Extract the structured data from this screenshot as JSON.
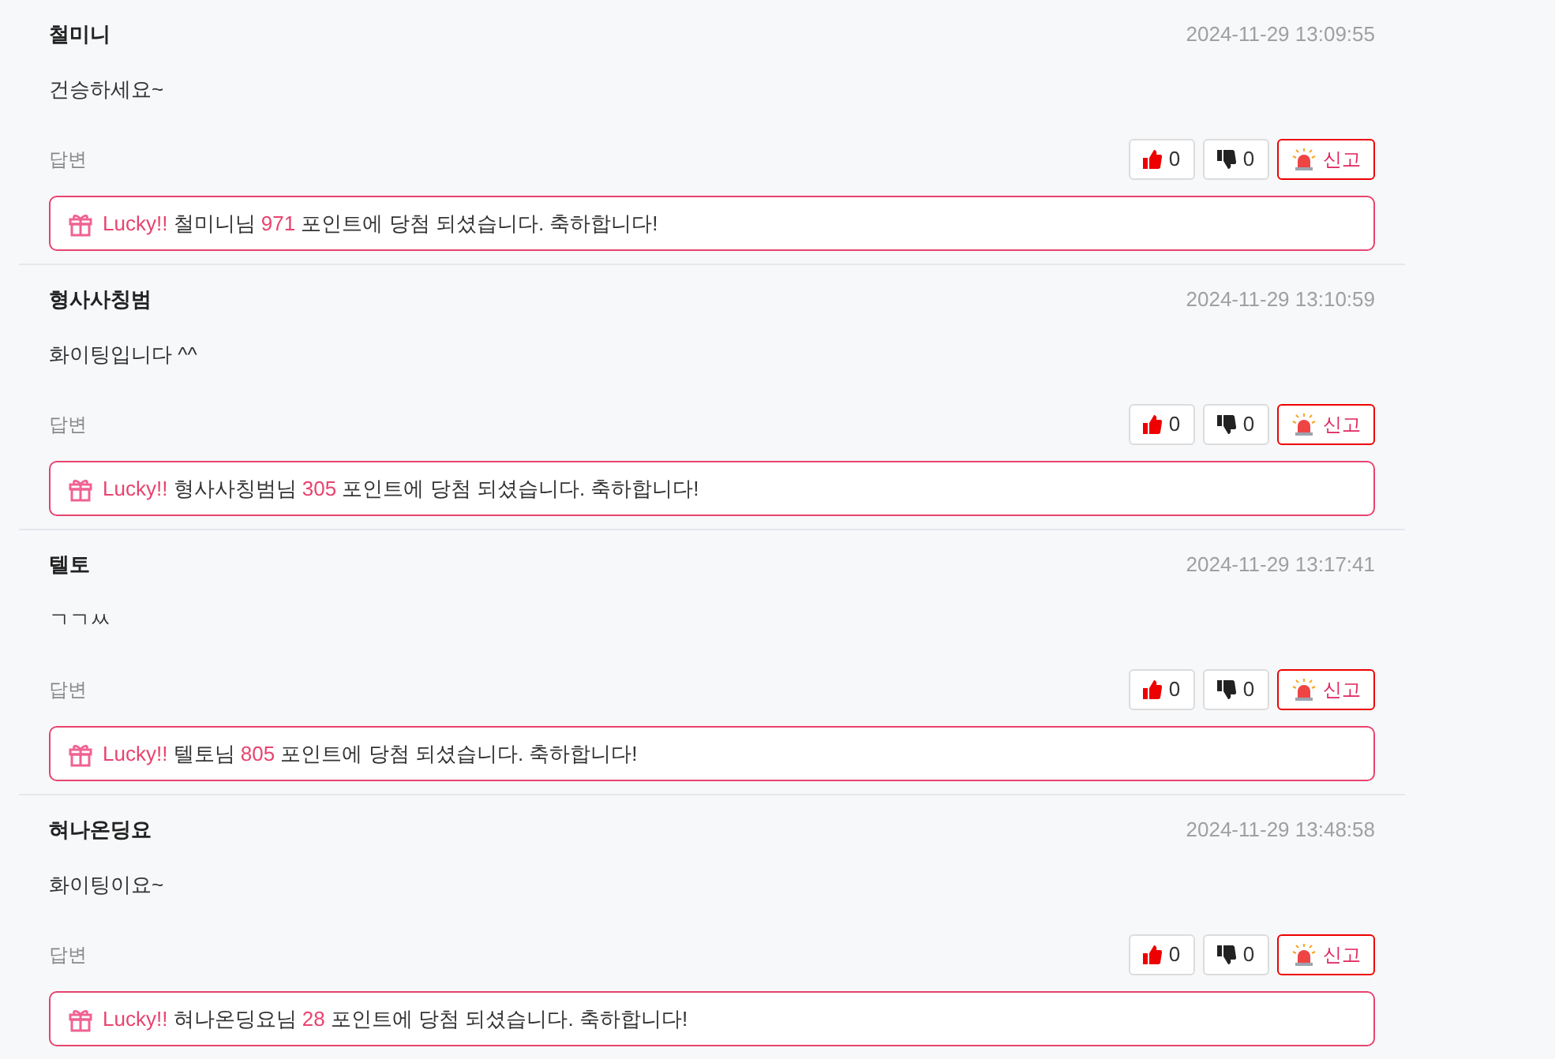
{
  "comments": [
    {
      "author": "철미니",
      "time": "2024-11-29 13:09:55",
      "body": "건승하세요~",
      "reply_label": "답변",
      "likes": "0",
      "dislikes": "0",
      "report": "신고",
      "lucky": {
        "label": "Lucky!!",
        "winner": "철미니님",
        "points": "971",
        "message": "포인트에 당첨 되셨습니다. 축하합니다!"
      }
    },
    {
      "author": "형사사칭범",
      "time": "2024-11-29 13:10:59",
      "body": "화이팅입니다 ^^",
      "reply_label": "답변",
      "likes": "0",
      "dislikes": "0",
      "report": "신고",
      "lucky": {
        "label": "Lucky!!",
        "winner": "형사사칭범님",
        "points": "305",
        "message": "포인트에 당첨 되셨습니다. 축하합니다!"
      }
    },
    {
      "author": "텔토",
      "time": "2024-11-29 13:17:41",
      "body": "ㄱㄱㅆ",
      "reply_label": "답변",
      "likes": "0",
      "dislikes": "0",
      "report": "신고",
      "lucky": {
        "label": "Lucky!!",
        "winner": "텔토님",
        "points": "805",
        "message": "포인트에 당첨 되셨습니다. 축하합니다!"
      }
    },
    {
      "author": "혀나온딩요",
      "time": "2024-11-29 13:48:58",
      "body": "화이팅이요~",
      "reply_label": "답변",
      "likes": "0",
      "dislikes": "0",
      "report": "신고",
      "lucky": {
        "label": "Lucky!!",
        "winner": "혀나온딩요님",
        "points": "28",
        "message": "포인트에 당첨 되셨습니다. 축하합니다!"
      }
    }
  ]
}
